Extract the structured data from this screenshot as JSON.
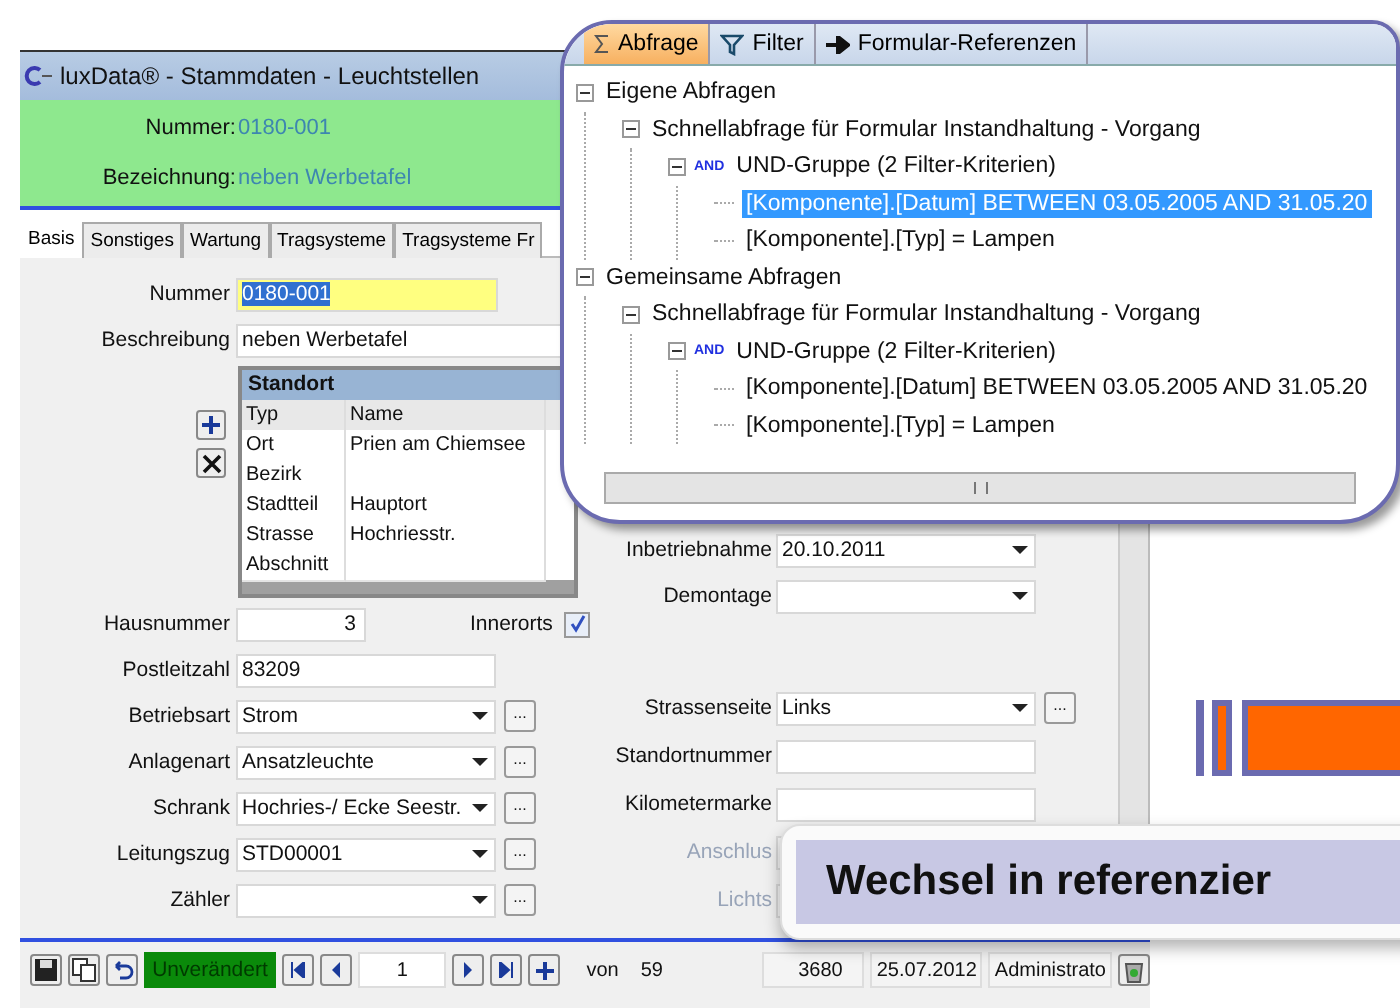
{
  "window": {
    "title": "luxData® - Stammdaten - Leuchtstellen"
  },
  "header": {
    "fields": [
      {
        "label": "Nummer:",
        "value": "0180-001"
      },
      {
        "label": "Bezeichnung:",
        "value": "neben Werbetafel"
      }
    ]
  },
  "tabs": [
    {
      "label": "Basis",
      "selected": true
    },
    {
      "label": "Sonstiges",
      "selected": false
    },
    {
      "label": "Wartung",
      "selected": false
    },
    {
      "label": "Tragsysteme",
      "selected": false
    },
    {
      "label": "Tragsysteme Fr",
      "selected": false
    }
  ],
  "form": {
    "nummer": {
      "label": "Nummer",
      "value": "0180-001"
    },
    "beschreibung": {
      "label": "Beschreibung",
      "value": "neben Werbetafel"
    },
    "standort": {
      "title": "Standort",
      "columns": [
        "Typ",
        "Name"
      ],
      "rows": [
        {
          "typ": "Ort",
          "name": "Prien am Chiemsee"
        },
        {
          "typ": "Bezirk"
        },
        {
          "typ": "Stadtteil",
          "name": "Hauptort"
        },
        {
          "typ": "Strasse",
          "name": "Hochriesstr."
        },
        {
          "typ": "Abschnitt"
        }
      ]
    },
    "innerorts": {
      "label": "Innerorts",
      "checked": true
    },
    "left_fields": [
      {
        "label": "Hausnummer",
        "value": "3",
        "kind": "number"
      },
      {
        "label": "Postleitzahl",
        "value": "83209",
        "kind": "text"
      },
      {
        "label": "Betriebsart",
        "value": "Strom",
        "kind": "combo",
        "button": "..."
      },
      {
        "label": "Anlagenart",
        "value": "Ansatzleuchte",
        "kind": "combo",
        "button": "..."
      },
      {
        "label": "Schrank",
        "value": "Hochries-/ Ecke Seestr.",
        "kind": "combo",
        "button": "..."
      },
      {
        "label": "Leitungszug",
        "value": "STD00001",
        "kind": "combo",
        "button": "..."
      },
      {
        "label": "Zähler",
        "kind": "combo",
        "button": "..."
      }
    ],
    "right_top": [
      {
        "label": "Inbetriebnahme",
        "value": "20.10.2011",
        "kind": "date",
        "disabled": false
      },
      {
        "label": "Demontage",
        "kind": "date",
        "disabled": false
      }
    ],
    "right_bottom": [
      {
        "label": "Strassenseite",
        "value": "Links",
        "kind": "combo",
        "button": "...",
        "disabled": false
      },
      {
        "label": "Standortnummer",
        "kind": "text",
        "disabled": false
      },
      {
        "label": "Kilometermarke",
        "kind": "text",
        "disabled": false
      },
      {
        "label": "Anschlus",
        "kind": "text",
        "disabled": true
      },
      {
        "label": "Lichts",
        "kind": "text",
        "disabled": true
      }
    ]
  },
  "footer": {
    "status": "Unverändert",
    "record": "1",
    "of_label": "von",
    "total": "59",
    "info": [
      "3680",
      "25.07.2012",
      "Administrato"
    ]
  },
  "query_panel": {
    "tabs": [
      {
        "label": "Abfrage",
        "selected": true
      },
      {
        "label": "Filter",
        "selected": false
      },
      {
        "label": "Formular-Referenzen",
        "selected": false
      }
    ],
    "tree": [
      {
        "label": "Eigene Abfragen",
        "expanded": true,
        "children": [
          {
            "label": "Schnellabfrage für Formular Instandhaltung - Vorgang",
            "expanded": true,
            "children": [
              {
                "label": "UND-Gruppe  (2 Filter-Kriterien)",
                "badge": "AND",
                "expanded": true,
                "children": [
                  {
                    "label": "[Komponente].[Datum] BETWEEN 03.05.2005 AND 31.05.20",
                    "selected": true
                  },
                  {
                    "label": "[Komponente].[Typ] = Lampen",
                    "selected": false
                  }
                ]
              }
            ]
          }
        ]
      },
      {
        "label": "Gemeinsame Abfragen",
        "expanded": true,
        "children": [
          {
            "label": "Schnellabfrage für Formular Instandhaltung - Vorgang",
            "expanded": true,
            "children": [
              {
                "label": "UND-Gruppe  (2 Filter-Kriterien)",
                "badge": "AND",
                "expanded": true,
                "children": [
                  {
                    "label": "[Komponente].[Datum] BETWEEN 03.05.2005 AND 31.05.20",
                    "selected": false
                  },
                  {
                    "label": "[Komponente].[Typ] = Lampen",
                    "selected": false
                  }
                ]
              }
            ]
          }
        ]
      }
    ]
  },
  "banner": {
    "text": "Wechsel in referenzier"
  }
}
